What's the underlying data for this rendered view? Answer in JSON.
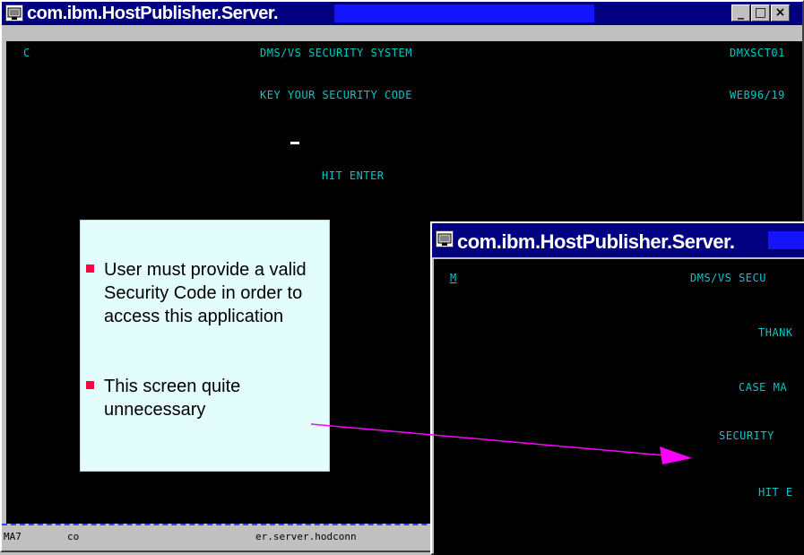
{
  "main_window": {
    "title": "com.ibm.HostPublisher.Server.",
    "controls": {
      "minimize": "_",
      "maximize": "□",
      "close": "×"
    },
    "terminal": {
      "row1_left": "C",
      "row1_center": "DMS/VS SECURITY SYSTEM",
      "row1_right": "DMXSCT01",
      "row2_center": "KEY YOUR SECURITY CODE",
      "row2_right": "WEB96/19",
      "prompt": "HIT ENTER"
    },
    "statusbar": {
      "left": "MA7",
      "mid": "co",
      "right": "er.server.hodconn"
    }
  },
  "second_window": {
    "title": "com.ibm.HostPublisher.Server.",
    "terminal": {
      "row1_left": "M",
      "row1_center": "DMS/VS SECU",
      "row2": "THANK",
      "row3": "CASE MA",
      "row4": "SECURITY",
      "row5": "HIT E"
    }
  },
  "callout": {
    "bullets": [
      "User must provide a valid Security Code in order to access this application",
      "This screen quite unnecessary"
    ]
  },
  "colors": {
    "terminal_text": "#00c8c8",
    "bullet": "#ff0040",
    "arrow": "#ff00ff",
    "callout_bg": "#e2fdfb"
  }
}
